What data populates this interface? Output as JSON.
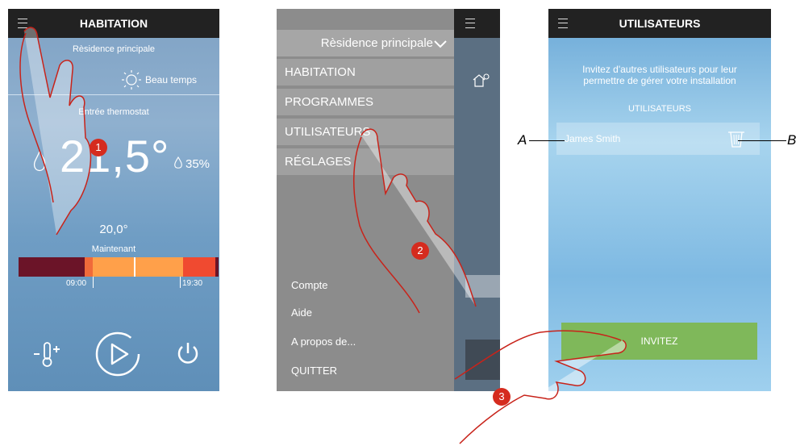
{
  "screen1": {
    "title": "HABITATION",
    "residence": "Rèsidence principale",
    "weather": "Beau temps",
    "thermostat_label": "Entrée thermostat",
    "temperature": "21,5°",
    "humidity": "35%",
    "setpoint": "20,0°",
    "now_label": "Maintenant",
    "time_start": "09:00",
    "time_end": "19:30",
    "badge": "1"
  },
  "screen2": {
    "residence": "Rèsidence principale",
    "menu": [
      "HABITATION",
      "PROGRAMMES",
      "UTILISATEURS",
      "RÉGLAGES"
    ],
    "links": [
      "Compte",
      "Aide",
      "A propos de...",
      "QUITTER"
    ],
    "badge": "2"
  },
  "screen3": {
    "title": "UTILISATEURS",
    "intro": "Invitez d'autres utilisateurs pour leur permettre de gérer votre installation",
    "users_header": "UTILISATEURS",
    "user_name": "James Smith",
    "invite_label": "INVITEZ",
    "badge": "3"
  },
  "callouts": {
    "a": "A",
    "b": "B"
  },
  "colors": {
    "accent": "#d52b1e",
    "invite": "#7fb85a",
    "timeline_dark": "#6b1428",
    "timeline_mid": "#f06a3a",
    "timeline_orange": "#ffa04a"
  }
}
